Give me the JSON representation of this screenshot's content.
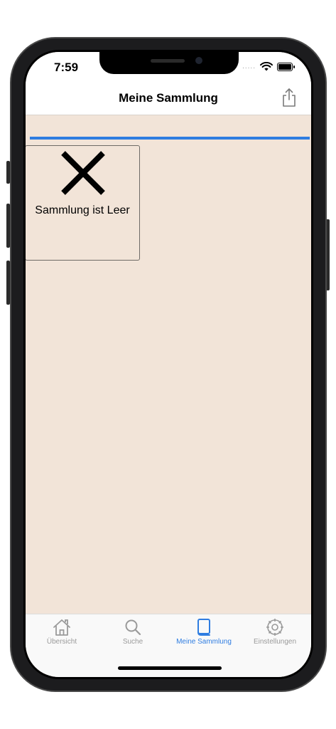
{
  "status_bar": {
    "time": "7:59",
    "dots": "....."
  },
  "nav": {
    "title": "Meine Sammlung",
    "share_icon": "share-icon"
  },
  "content": {
    "progress_color": "#2f7de1",
    "empty_icon": "x-icon",
    "empty_message": "Sammlung ist Leer"
  },
  "tabbar": {
    "tabs": [
      {
        "label": "Übersicht",
        "icon": "home-icon",
        "active": false
      },
      {
        "label": "Suche",
        "icon": "search-icon",
        "active": false
      },
      {
        "label": "Meine Sammlung",
        "icon": "book-icon",
        "active": true
      },
      {
        "label": "Einstellungen",
        "icon": "gear-icon",
        "active": false
      }
    ]
  },
  "colors": {
    "accent": "#2f7de1",
    "background": "#f2e4d8",
    "inactive": "#9a9a9a"
  }
}
